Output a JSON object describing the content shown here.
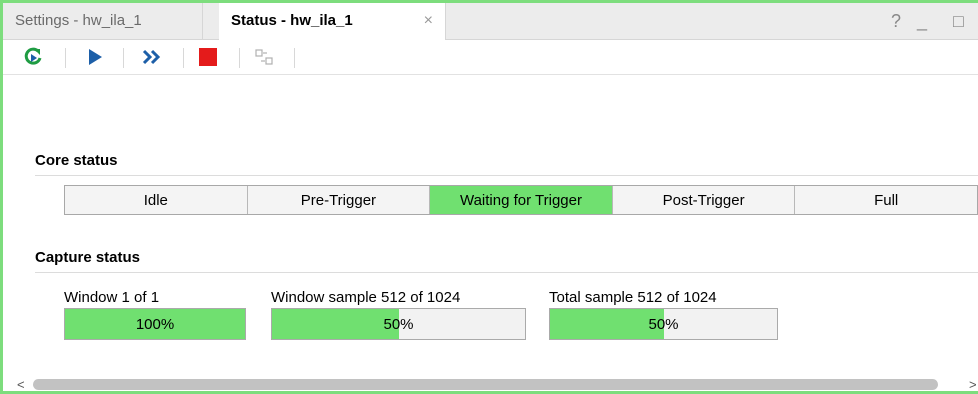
{
  "tabs": [
    {
      "label": "Settings - hw_ila_1",
      "active": false
    },
    {
      "label": "Status - hw_ila_1",
      "active": true,
      "close": "×"
    }
  ],
  "window_controls": {
    "help": "?",
    "minimize": "_",
    "maximize": "□"
  },
  "toolbar": {
    "icons": [
      "run-trigger-immediate-icon",
      "run-trigger-icon",
      "run-trigger-continuous-icon",
      "stop-trigger-icon",
      "toggle-layout-icon"
    ],
    "colors": {
      "green": "#1f9c43",
      "blue": "#1d5fa8",
      "red": "#e41b1b"
    }
  },
  "core_status": {
    "title": "Core status",
    "states": [
      "Idle",
      "Pre-Trigger",
      "Waiting for Trigger",
      "Post-Trigger",
      "Full"
    ],
    "active_index": 2,
    "active_color": "#70e070"
  },
  "capture_status": {
    "title": "Capture status",
    "items": [
      {
        "label": "Window 1 of 1",
        "percent_text": "100%",
        "fraction": 1.0
      },
      {
        "label": "Window sample 512 of 1024",
        "percent_text": "50%",
        "fraction": 0.5
      },
      {
        "label": "Total sample 512 of 1024",
        "percent_text": "50%",
        "fraction": 0.5
      }
    ]
  },
  "scrollbar": {
    "left_arrow": "<",
    "right_arrow": ">"
  }
}
